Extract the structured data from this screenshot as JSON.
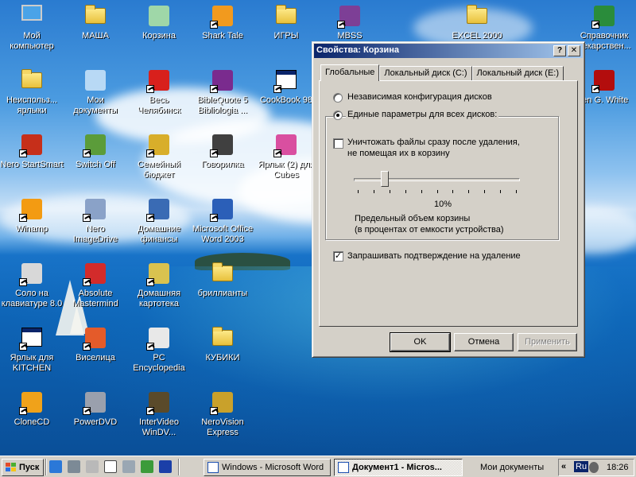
{
  "desktop_icons": [
    {
      "label": "Мой\nкомпьютер",
      "icon": "my-computer-icon"
    },
    {
      "label": "МАША",
      "icon": "folder-icon"
    },
    {
      "label": "Корзина",
      "icon": "recycle-bin-icon"
    },
    {
      "label": "Shark Tale",
      "icon": "shark-tale-icon"
    },
    {
      "label": "ИГРЫ",
      "icon": "folder-icon"
    },
    {
      "label": "MBSS",
      "icon": "mbss-icon"
    },
    {
      "label": "EXCEL 2000",
      "icon": "folder-icon"
    },
    {
      "label": "Справочник\nлекарствен...",
      "icon": "syringe-icon"
    },
    {
      "label": "Неиспольз...\nярлыки",
      "icon": "folder-icon"
    },
    {
      "label": "Мои\nдокументы",
      "icon": "my-documents-icon"
    },
    {
      "label": "Весь\nЧелябинск",
      "icon": "vch-icon"
    },
    {
      "label": "BibleQuote 5\nBibliologia ...",
      "icon": "bible-icon"
    },
    {
      "label": "CookBook 98",
      "icon": "cookbook-icon"
    },
    {
      "label": "len G. White",
      "icon": "egw-icon"
    },
    {
      "label": "Nero StartSmart",
      "icon": "nero-startsmart-icon"
    },
    {
      "label": "Switch Off",
      "icon": "power-plug-icon"
    },
    {
      "label": "Семейный\nбюджет",
      "icon": "coins-icon"
    },
    {
      "label": "Говорилка",
      "icon": "speaker-icon"
    },
    {
      "label": "Ярлык (2) для\nCubes",
      "icon": "cubes-icon"
    },
    {
      "label": "Winamp",
      "icon": "winamp-icon"
    },
    {
      "label": "Nero\nImageDrive",
      "icon": "nero-imagedrive-icon"
    },
    {
      "label": "Домашние\nфинансы",
      "icon": "house-icon"
    },
    {
      "label": "Microsoft Office\nWord 2003",
      "icon": "word-icon"
    },
    {
      "label": "Соло на\nклавиатуре 8.0",
      "icon": "keyboard-key-icon"
    },
    {
      "label": "Absolute\nMastermind",
      "icon": "mastermind-icon"
    },
    {
      "label": "Домашняя\nкартотека",
      "icon": "card-index-icon"
    },
    {
      "label": "бриллианты",
      "icon": "folder-icon"
    },
    {
      "label": "Ярлык для\nKITCHEN",
      "icon": "app-window-icon"
    },
    {
      "label": "Виселица",
      "icon": "abc-blocks-icon"
    },
    {
      "label": "PC\nEncyclopedia",
      "icon": "pc-encyclopedia-icon"
    },
    {
      "label": "КУБИКИ",
      "icon": "folder-icon"
    },
    {
      "label": "CloneCD",
      "icon": "clonecd-icon"
    },
    {
      "label": "PowerDVD",
      "icon": "powerdvd-icon"
    },
    {
      "label": "InterVideo\nWinDV...",
      "icon": "film-icon"
    },
    {
      "label": "NeroVision\nExpress",
      "icon": "nerovision-icon"
    }
  ],
  "dialog": {
    "title": "Свойства: Корзина",
    "help_btn": "?",
    "close_btn": "✕",
    "tabs": [
      "Глобальные",
      "Локальный диск (C:)",
      "Локальный диск (E:)"
    ],
    "radio_independent": "Независимая конфигурация дисков",
    "radio_common": "Единые параметры для всех дисков:",
    "delete_immediately_line1": "Уничтожать файлы сразу после удаления,",
    "delete_immediately_line2": "не помещая их в корзину",
    "delete_immediately_checked": false,
    "slider_percent_text": "10%",
    "slider_value": 10,
    "max_size_line1": "Предельный объем корзины",
    "max_size_line2": "(в процентах от емкости устройства)",
    "confirm_delete": "Запрашивать подтверждение на удаление",
    "confirm_delete_checked": true,
    "ok": "OK",
    "cancel": "Отмена",
    "apply": "Применить"
  },
  "taskbar": {
    "start": "Пуск",
    "tasks": [
      "Windows - Microsoft Word",
      "Документ1 - Micros..."
    ],
    "my_documents": "Мои документы",
    "chevron": "«",
    "lang": "Ru",
    "time": "18:26"
  }
}
